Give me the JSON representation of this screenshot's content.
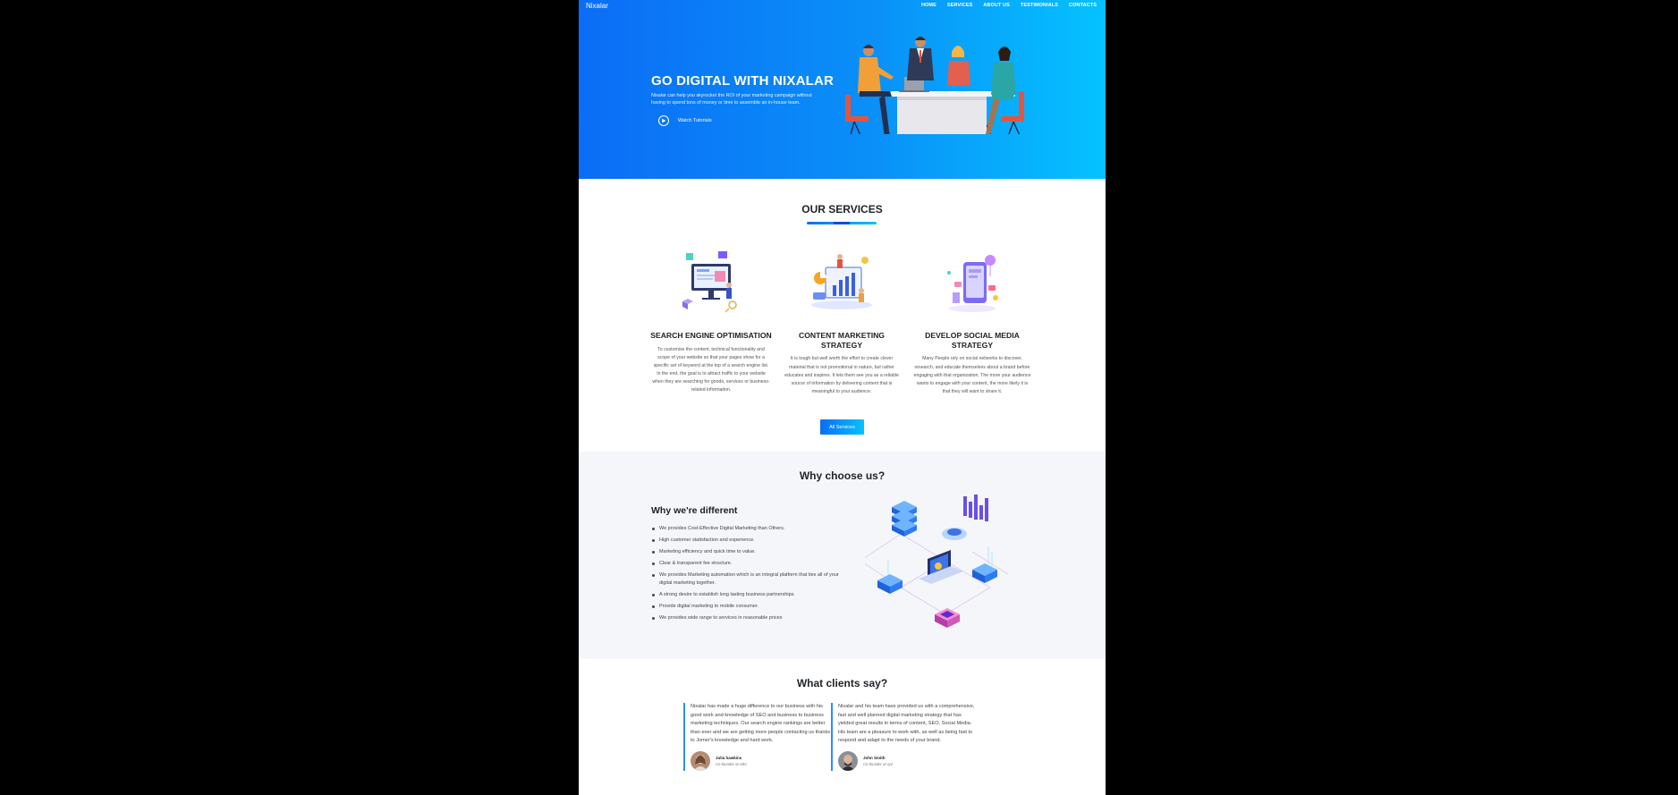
{
  "brand": "Nixalar",
  "nav": [
    "HOME",
    "SERVICES",
    "ABOUT US",
    "TESTIMONIALS",
    "CONTACTS"
  ],
  "hero": {
    "title": "GO DIGITAL WITH NIXALAR",
    "subtitle": "Nixalar can help you skyrocket the ROI of your marketing campaign without having to spend tons of money or time to assemble an in-house team.",
    "watch_label": "Watch Tutorials"
  },
  "services": {
    "title": "OUR SERVICES",
    "items": [
      {
        "title": "SEARCH ENGINE OPTIMISATION",
        "text": "To customise the content, technical functionality and scope of your website so that your pages show for a specific set of keyword at the top of a search engine list. In the end, the goal is to attract traffic to your website when they are searching for goods, services or business-related information."
      },
      {
        "title": "CONTENT MARKETING STRATEGY",
        "text": "It is tough but well worth the effort to create clever material that is not promotional in nature, but rather educates and inspires. It lets them see you as a reliable source of information by delivering content that is meaningful to your audience."
      },
      {
        "title": "DEVELOP SOCIAL MEDIA STRATEGY",
        "text": "Many People rely on social networks to discover, research, and educate themselves about a brand before engaging with that organization. The more your audience wants to engage with your content, the more likely it is that they will want to share it."
      }
    ],
    "button": "All Services"
  },
  "why": {
    "title": "Why choose us?",
    "heading": "Why we're different",
    "items": [
      "We provides Cost-Effective Digital Marketing than Others.",
      "High customer statisfaction and experience.",
      "Marketing efficiency and quick time to value.",
      "Clear & transparent fee structure.",
      "We provides Marketing automation which is an integral platform that ties all of your digital marketing together.",
      "A strong desire to establish long lasting business partnerships.",
      "Provide digital marketing to mobile consumer.",
      "We provides wide range to services in reasonable prices"
    ]
  },
  "clients": {
    "title": "What clients say?",
    "items": [
      {
        "quote": "Nixalar has made a huge difference to our business with his good work and knowledge of SEO and business to business marketing techniques. Our search engine rankings are better than ever and we are getting more people contacting us thanks to Jomer's knowledge and hard work.",
        "name": "Julia hawkins",
        "role": "Co-founder at ABC"
      },
      {
        "quote": "Nixalar and his team have provided us with a comprehensive, fast and well planned digital marketing strategy that has yielded great results in terms of content, SEO, Social Media. His team are a pleasure to work with, as well as being fast to respond and adapt to the needs of your brand.",
        "name": "John Smith",
        "role": "Co-founder at xyz"
      }
    ]
  },
  "colors": {
    "accent": "#0b6df6",
    "accent_light": "#05c2ff",
    "section_bg": "#f4f6f9"
  }
}
